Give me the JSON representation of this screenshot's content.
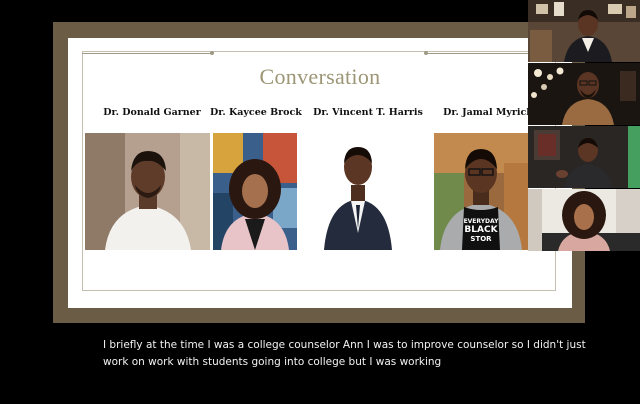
{
  "slide": {
    "title": "Conversation",
    "panelists": [
      {
        "name": "Dr. Donald Garner"
      },
      {
        "name": "Dr. Kaycee Brock"
      },
      {
        "name": "Dr. Vincent T. Harris"
      },
      {
        "name": "Dr. Jamal Myrick"
      }
    ]
  },
  "shirt_text": {
    "line1": "EVERYDAY",
    "line2": "BLACK",
    "line3": "STOR"
  },
  "participants": [
    {
      "id": "participant-1"
    },
    {
      "id": "participant-2"
    },
    {
      "id": "participant-3"
    },
    {
      "id": "participant-4"
    }
  ],
  "captions": {
    "line1": "I briefly at the time I was a college counselor Ann I was to improve counselor so I didn't just",
    "line2": "work on work with students going into college but I was working"
  },
  "colors": {
    "frame": "#6a5c45",
    "title": "#9c9676",
    "background": "#000000"
  }
}
